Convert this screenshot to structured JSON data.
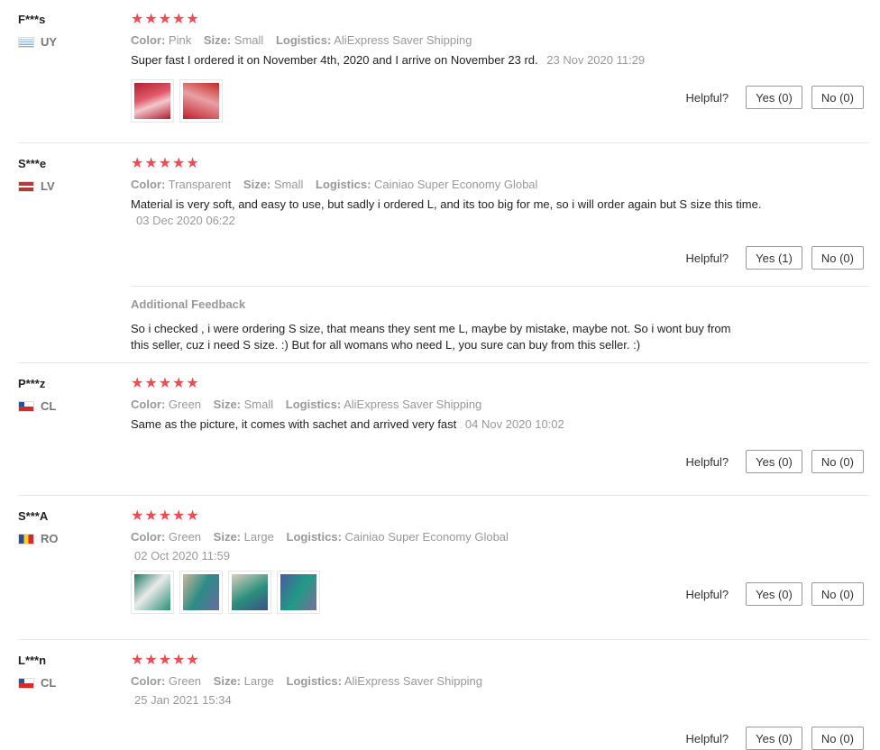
{
  "helpful_label": "Helpful?",
  "star_glyph": "★★★★★",
  "colors": {
    "star": "#f24a54",
    "muted": "#999999",
    "separator": "#e8e8e8"
  },
  "reviews": [
    {
      "user": "F***s",
      "country": "UY",
      "rating": 5,
      "attrs": {
        "color_label": "Color:",
        "color": "Pink",
        "size_label": "Size:",
        "size": "Small",
        "logistics_label": "Logistics:",
        "logistics": "AliExpress Saver Shipping"
      },
      "text": "Super fast I ordered it on November 4th, 2020 and I arrive on November 23 rd.",
      "date": "23 Nov 2020 11:29",
      "yes": "Yes (0)",
      "no": "No (0)"
    },
    {
      "user": "S***e",
      "country": "LV",
      "rating": 5,
      "attrs": {
        "color_label": "Color:",
        "color": "Transparent",
        "size_label": "Size:",
        "size": "Small",
        "logistics_label": "Logistics:",
        "logistics": "Cainiao Super Economy Global"
      },
      "text": "Material is very soft, and easy to use, but sadly i ordered L, and its too big for me, so i will order again but S size this time.",
      "date": "03 Dec 2020 06:22",
      "yes": "Yes (1)",
      "no": "No (0)",
      "additional_feedback_title": "Additional Feedback",
      "additional_feedback": "So i checked , i were ordering S size, that means they sent me L, maybe by mistake, maybe not. So i wont buy from this seller, cuz i need S size. :) But for all womans who need L, you sure can buy from this seller. :)"
    },
    {
      "user": "P***z",
      "country": "CL",
      "rating": 5,
      "attrs": {
        "color_label": "Color:",
        "color": "Green",
        "size_label": "Size:",
        "size": "Small",
        "logistics_label": "Logistics:",
        "logistics": "AliExpress Saver Shipping"
      },
      "text": "Same as the picture, it comes with sachet and arrived very fast",
      "date": "04 Nov 2020 10:02",
      "yes": "Yes (0)",
      "no": "No (0)"
    },
    {
      "user": "S***A",
      "country": "RO",
      "rating": 5,
      "attrs": {
        "color_label": "Color:",
        "color": "Green",
        "size_label": "Size:",
        "size": "Large",
        "logistics_label": "Logistics:",
        "logistics": "Cainiao Super Economy Global"
      },
      "date": "02 Oct 2020 11:59",
      "yes": "Yes (0)",
      "no": "No (0)"
    },
    {
      "user": "L***n",
      "country": "CL",
      "rating": 5,
      "attrs": {
        "color_label": "Color:",
        "color": "Green",
        "size_label": "Size:",
        "size": "Large",
        "logistics_label": "Logistics:",
        "logistics": "AliExpress Saver Shipping"
      },
      "date": "25 Jan 2021 15:34",
      "yes": "Yes (0)",
      "no": "No (0)"
    }
  ]
}
